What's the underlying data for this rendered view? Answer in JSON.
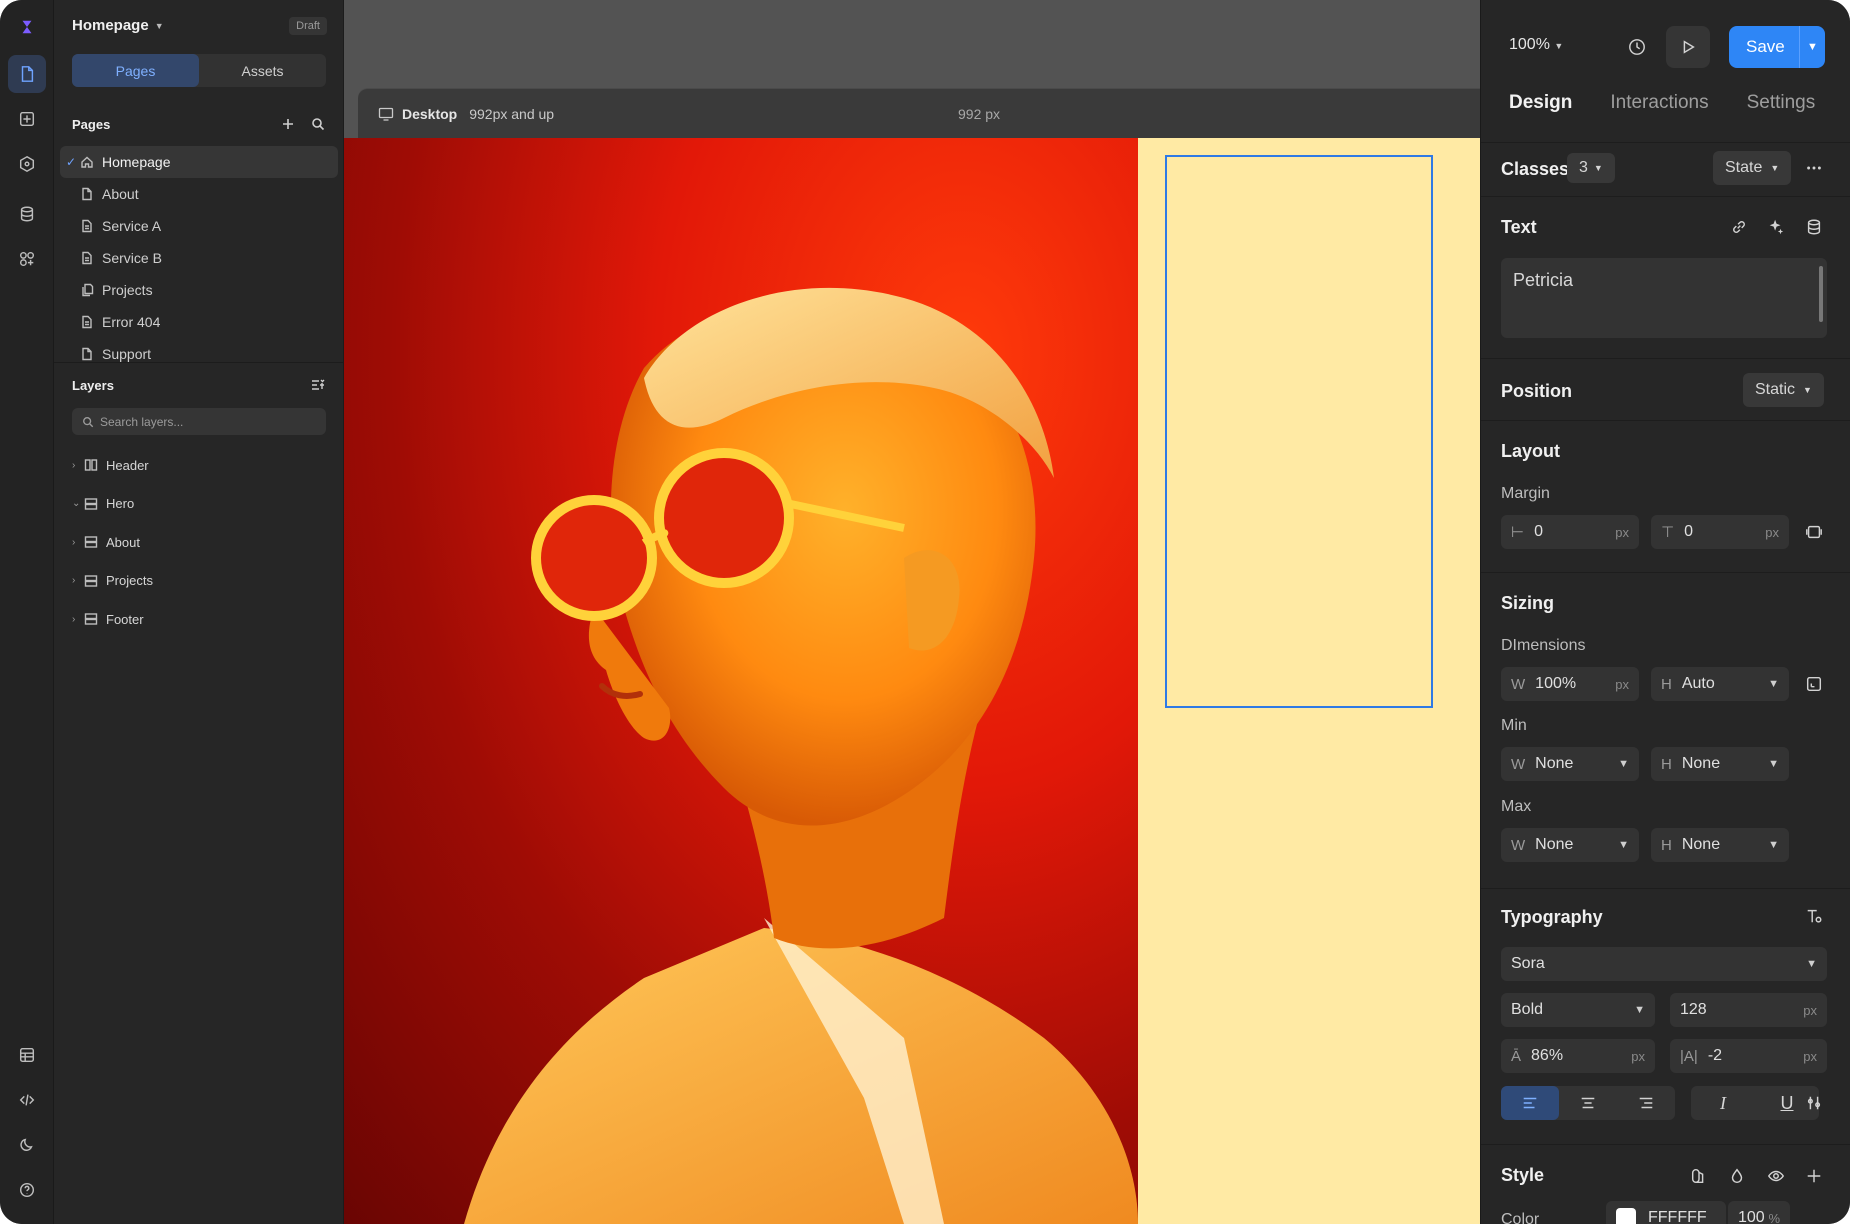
{
  "project": {
    "title": "Homepage",
    "status": "Draft"
  },
  "left_tabs": [
    "Pages",
    "Assets"
  ],
  "pages": {
    "heading": "Pages",
    "items": [
      {
        "label": "Homepage",
        "icon": "home-icon",
        "selected": true
      },
      {
        "label": "About",
        "icon": "file-icon"
      },
      {
        "label": "Service A",
        "icon": "file-text-icon"
      },
      {
        "label": "Service B",
        "icon": "file-text-icon"
      },
      {
        "label": "Projects",
        "icon": "files-icon"
      },
      {
        "label": "Error 404",
        "icon": "file-text-icon"
      },
      {
        "label": "Support",
        "icon": "file-icon"
      }
    ]
  },
  "layers": {
    "heading": "Layers",
    "search_placeholder": "Search layers...",
    "items": [
      {
        "label": "Header",
        "expanded": false
      },
      {
        "label": "Hero",
        "expanded": true
      },
      {
        "label": "About",
        "expanded": false
      },
      {
        "label": "Projects",
        "expanded": false
      },
      {
        "label": "Footer",
        "expanded": false
      }
    ]
  },
  "canvas": {
    "viewport_name": "Desktop",
    "viewport_range": "992px and up",
    "viewport_width": "992 px",
    "frame_color": "#ffeaa4",
    "selection_color": "#2f7ae5"
  },
  "toolbar": {
    "zoom": "100%",
    "save_label": "Save"
  },
  "right_tabs": [
    "Design",
    "Interactions",
    "Settings"
  ],
  "classes": {
    "label": "Classes",
    "count": "3",
    "state_label": "State"
  },
  "text": {
    "label": "Text",
    "value": "Petricia"
  },
  "position": {
    "label": "Position",
    "value": "Static"
  },
  "layout": {
    "label": "Layout",
    "margin_label": "Margin",
    "margin_h": "0",
    "margin_v": "0",
    "unit": "px"
  },
  "sizing": {
    "label": "Sizing",
    "dimensions_label": "DImensions",
    "width": "100%",
    "height": "Auto",
    "min_label": "Min",
    "min_w": "None",
    "min_h": "None",
    "max_label": "Max",
    "max_w": "None",
    "max_h": "None",
    "unit": "px",
    "w_prefix": "W",
    "h_prefix": "H"
  },
  "typography": {
    "label": "Typography",
    "font": "Sora",
    "weight": "Bold",
    "size": "128",
    "line_height": "86%",
    "letter_spacing": "-2",
    "unit": "px"
  },
  "style": {
    "label": "Style",
    "color_label": "Color",
    "color_hex": "FFFFFF",
    "opacity": "100",
    "opacity_unit": "%"
  },
  "accent_color": "#2e86f6"
}
